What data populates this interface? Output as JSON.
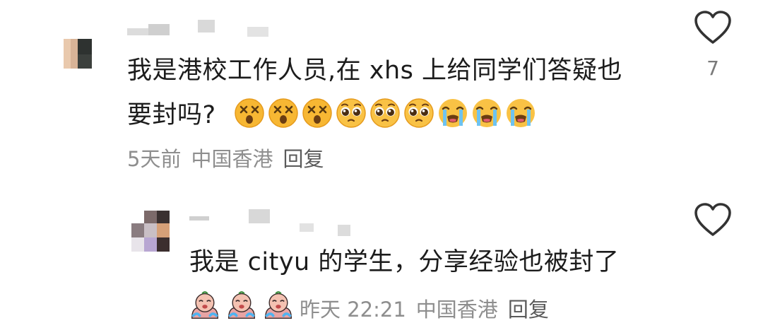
{
  "comments": [
    {
      "text_line1": "我是港校工作人员,在 xhs 上给同学们答疑也",
      "text_line2": "要封吗?",
      "emojis": [
        "dizzy-face-emoji",
        "dizzy-face-emoji",
        "dizzy-face-emoji",
        "pleading-face-emoji",
        "pleading-face-emoji",
        "pleading-face-emoji",
        "crying-face-emoji",
        "crying-face-emoji",
        "crying-face-emoji"
      ],
      "time": "5天前",
      "location": "中国香港",
      "reply_label": "回复",
      "like_count": "7",
      "like_icon": "heart-outline-icon"
    },
    {
      "text": "我是 cityu 的学生，分享经验也被封了",
      "sticker_count": 3,
      "time": "昨天 22:21",
      "location": "中国香港",
      "reply_label": "回复",
      "like_icon": "heart-outline-icon"
    }
  ],
  "colors": {
    "text": "#1c1c1c",
    "meta": "#8e8e8e",
    "emoji_yellow": "#f6b93b",
    "heart_stroke": "#333333"
  }
}
